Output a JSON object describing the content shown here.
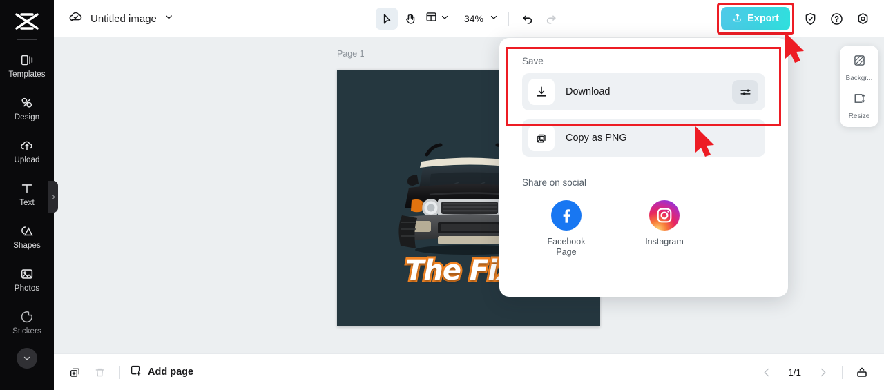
{
  "app": {
    "brand_icon": "capcut-logo-icon",
    "accent_export": "#3fd2e2",
    "annotation_color": "#ed1c24",
    "canvas_bg": "#25373f"
  },
  "sidebar": {
    "items": [
      {
        "label": "Templates",
        "icon": "templates-icon"
      },
      {
        "label": "Design",
        "icon": "design-icon"
      },
      {
        "label": "Upload",
        "icon": "upload-cloud-icon"
      },
      {
        "label": "Text",
        "icon": "text-icon"
      },
      {
        "label": "Shapes",
        "icon": "shapes-icon"
      },
      {
        "label": "Photos",
        "icon": "photos-icon"
      },
      {
        "label": "Stickers",
        "icon": "stickers-icon"
      }
    ],
    "expand_icon": "chevron-down-icon",
    "collapse_handle_icon": "chevron-right-icon"
  },
  "topbar": {
    "cloud_icon": "cloud-saved-icon",
    "doc_title": "Untitled image",
    "doc_menu_icon": "chevron-down-icon",
    "tools": {
      "select_icon": "cursor-select-icon",
      "hand_icon": "hand-pan-icon",
      "layout_icon": "layout-grid-icon",
      "layout_chevron": "chevron-down-icon",
      "zoom_value": "34%",
      "zoom_chevron": "chevron-down-icon",
      "undo_icon": "undo-icon",
      "redo_icon": "redo-icon"
    },
    "export_label": "Export",
    "export_icon": "export-upload-icon",
    "shield_icon": "shield-check-icon",
    "help_icon": "help-question-icon",
    "settings_icon": "settings-gear-icon"
  },
  "canvas": {
    "page_label": "Page 1",
    "artwork": {
      "title_text": "The Fixe",
      "title_fill": "#ffffff",
      "title_outline": "#f18322",
      "background": "#25373f",
      "subject": "black-suv-photo"
    }
  },
  "export_panel": {
    "save_section_label": "Save",
    "options": [
      {
        "label": "Download",
        "icon": "download-icon",
        "settings_icon": "sliders-settings-icon"
      },
      {
        "label": "Copy as PNG",
        "icon": "copy-image-icon"
      }
    ],
    "social_section_label": "Share on social",
    "social": [
      {
        "label": "Facebook\nPage",
        "label_line1": "Facebook",
        "label_line2": "Page",
        "icon": "facebook-icon"
      },
      {
        "label": "Instagram",
        "label_line1": "Instagram",
        "label_line2": "",
        "icon": "instagram-icon"
      }
    ]
  },
  "right_panel": {
    "items": [
      {
        "label": "Backgr...",
        "icon": "background-pattern-icon"
      },
      {
        "label": "Resize",
        "icon": "resize-icon"
      }
    ]
  },
  "bottombar": {
    "duplicate_icon": "duplicate-page-icon",
    "delete_icon": "trash-icon",
    "add_page_label": "Add page",
    "add_page_icon": "add-page-icon",
    "prev_icon": "chevron-left-icon",
    "page_indicator": "1/1",
    "next_icon": "chevron-right-icon",
    "expand_icon": "expand-panel-icon"
  }
}
